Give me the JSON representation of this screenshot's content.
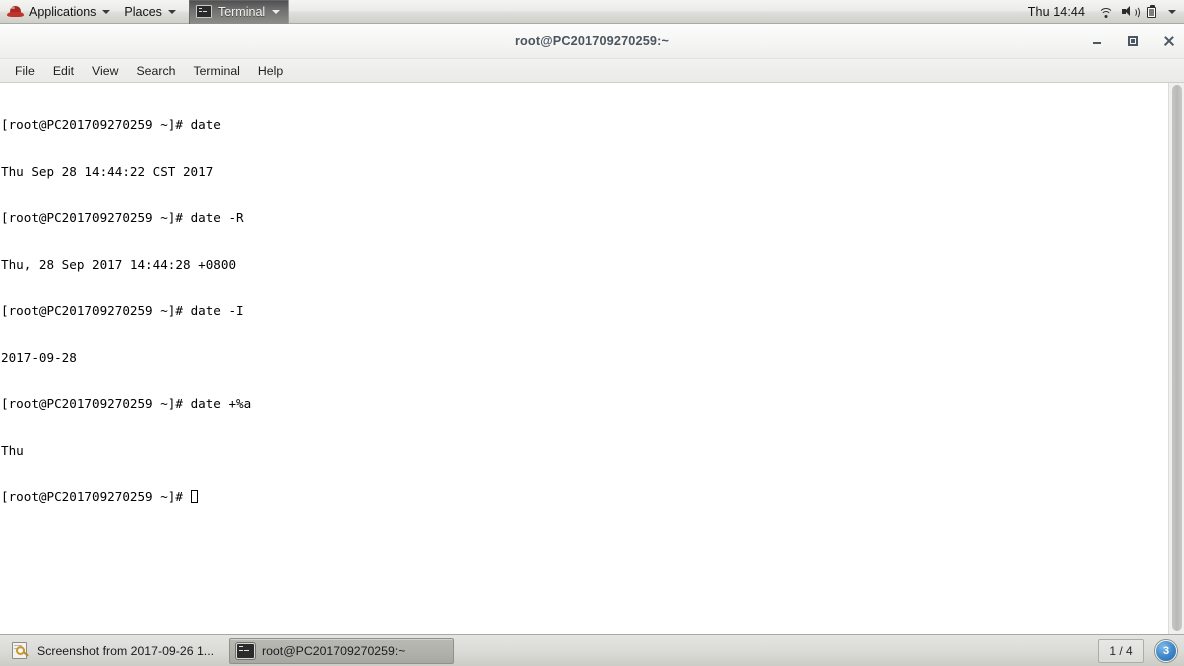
{
  "top_panel": {
    "applications_label": "Applications",
    "places_label": "Places",
    "window_task_label": "Terminal",
    "clock": "Thu 14:44",
    "icons": [
      "redhat-logo",
      "terminal-icon",
      "wifi-icon",
      "volume-icon",
      "battery-icon",
      "chevron-down-icon"
    ]
  },
  "window": {
    "title": "root@PC201709270259:~",
    "buttons": {
      "minimize": "minimize",
      "maximize": "maximize",
      "close": "close"
    },
    "menubar": [
      "File",
      "Edit",
      "View",
      "Search",
      "Terminal",
      "Help"
    ]
  },
  "terminal": {
    "prompt": "[root@PC201709270259 ~]#",
    "lines": [
      {
        "type": "prompt",
        "prompt": "[root@PC201709270259 ~]# ",
        "command": "date"
      },
      {
        "type": "output",
        "text": "Thu Sep 28 14:44:22 CST 2017"
      },
      {
        "type": "prompt",
        "prompt": "[root@PC201709270259 ~]# ",
        "command": "date -R"
      },
      {
        "type": "output",
        "text": "Thu, 28 Sep 2017 14:44:28 +0800"
      },
      {
        "type": "prompt",
        "prompt": "[root@PC201709270259 ~]# ",
        "command": "date -I"
      },
      {
        "type": "output",
        "text": "2017-09-28"
      },
      {
        "type": "prompt",
        "prompt": "[root@PC201709270259 ~]# ",
        "command": "date +%a"
      },
      {
        "type": "output",
        "text": "Thu"
      },
      {
        "type": "cursor",
        "prompt": "[root@PC201709270259 ~]# "
      }
    ],
    "text_color": "#000000",
    "background_color": "#ffffff"
  },
  "bottom_panel": {
    "tasks": [
      {
        "label": "Screenshot from 2017-09-26 1...",
        "icon": "screenshot-icon",
        "active": false
      },
      {
        "label": "root@PC201709270259:~",
        "icon": "terminal-icon",
        "active": true
      }
    ],
    "workspace_indicator": "1 / 4",
    "notification_count": "3"
  }
}
